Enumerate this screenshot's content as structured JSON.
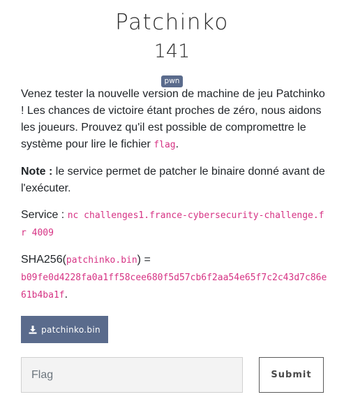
{
  "challenge": {
    "title": "Patchinko",
    "points": "141",
    "tag": "pwn"
  },
  "description": {
    "p1_text": "Venez tester la nouvelle version de machine de jeu Patchinko ! Les chances de victoire étant proches de zéro, nous aidons les joueurs. Prouvez qu'il est possible de compromettre le système pour lire le fichier ",
    "p1_code": "flag",
    "p1_end": ".",
    "note_label": "Note :",
    "note_text": " le service permet de patcher le binaire donné avant de l'exécuter.",
    "service_label": "Service : ",
    "service_code": "nc challenges1.france-cybersecurity-challenge.fr 4009",
    "sha_label": "SHA256(",
    "sha_file": "patchinko.bin",
    "sha_eq": ") =",
    "sha_hash": "b09fe0d4228fa0a1ff58cee680f5d57cb6f2aa54e65f7c2c43d7c86e61b4ba1f",
    "sha_end": "."
  },
  "download": {
    "label": "patchinko.bin",
    "icon": "download-icon"
  },
  "flag_form": {
    "placeholder": "Flag",
    "value": "",
    "submit_label": "Submit"
  },
  "colors": {
    "accent": "#5a6b8c",
    "code": "#d63384"
  }
}
